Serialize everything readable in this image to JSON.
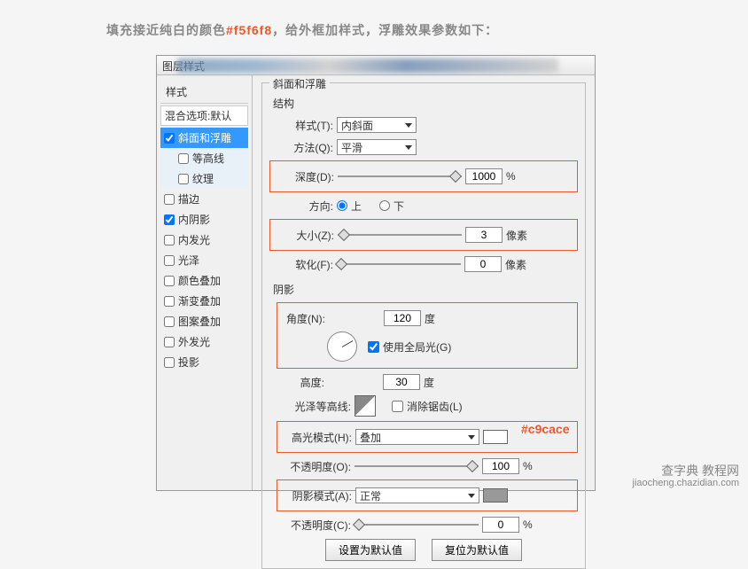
{
  "caption": {
    "pre": "填充接近纯白的颜色",
    "hex": "#f5f6f8",
    "post": "，给外框加样式，浮雕效果参数如下："
  },
  "dialog_title": "图层样式",
  "sidebar": {
    "styles_label": "样式",
    "blend_label": "混合选项:默认",
    "items": [
      {
        "label": "斜面和浮雕",
        "checked": true,
        "selected": true
      },
      {
        "label": "等高线",
        "checked": false,
        "sub": true
      },
      {
        "label": "纹理",
        "checked": false,
        "sub": true
      },
      {
        "label": "描边",
        "checked": false
      },
      {
        "label": "内阴影",
        "checked": true
      },
      {
        "label": "内发光",
        "checked": false
      },
      {
        "label": "光泽",
        "checked": false
      },
      {
        "label": "颜色叠加",
        "checked": false
      },
      {
        "label": "渐变叠加",
        "checked": false
      },
      {
        "label": "图案叠加",
        "checked": false
      },
      {
        "label": "外发光",
        "checked": false
      },
      {
        "label": "投影",
        "checked": false
      }
    ]
  },
  "panel_title": "斜面和浮雕",
  "structure": {
    "legend": "结构",
    "style": {
      "label": "样式(T):",
      "value": "内斜面"
    },
    "technique": {
      "label": "方法(Q):",
      "value": "平滑"
    },
    "depth": {
      "label": "深度(D):",
      "value": "1000",
      "unit": "%"
    },
    "direction": {
      "label": "方向:",
      "up": "上",
      "down": "下"
    },
    "size": {
      "label": "大小(Z):",
      "value": "3",
      "unit": "像素"
    },
    "soften": {
      "label": "软化(F):",
      "value": "0",
      "unit": "像素"
    }
  },
  "shading": {
    "legend": "阴影",
    "angle": {
      "label": "角度(N):",
      "value": "120",
      "unit": "度"
    },
    "global": {
      "label": "使用全局光(G)"
    },
    "altitude": {
      "label": "高度:",
      "value": "30",
      "unit": "度"
    },
    "gloss": {
      "label": "光泽等高线:",
      "antialias": "消除锯齿(L)"
    },
    "highlight_mode": {
      "label": "高光模式(H):",
      "value": "叠加"
    },
    "highlight_opacity": {
      "label": "不透明度(O):",
      "value": "100",
      "unit": "%"
    },
    "shadow_mode": {
      "label": "阴影模式(A):",
      "value": "正常"
    },
    "shadow_opacity": {
      "label": "不透明度(C):",
      "value": "0",
      "unit": "%"
    }
  },
  "buttons": {
    "default": "设置为默认值",
    "reset": "复位为默认值"
  },
  "annot_color": "#c9cace",
  "watermark": {
    "line1": "查字典 教程网",
    "line2": "jiaocheng.chazidian.com"
  }
}
